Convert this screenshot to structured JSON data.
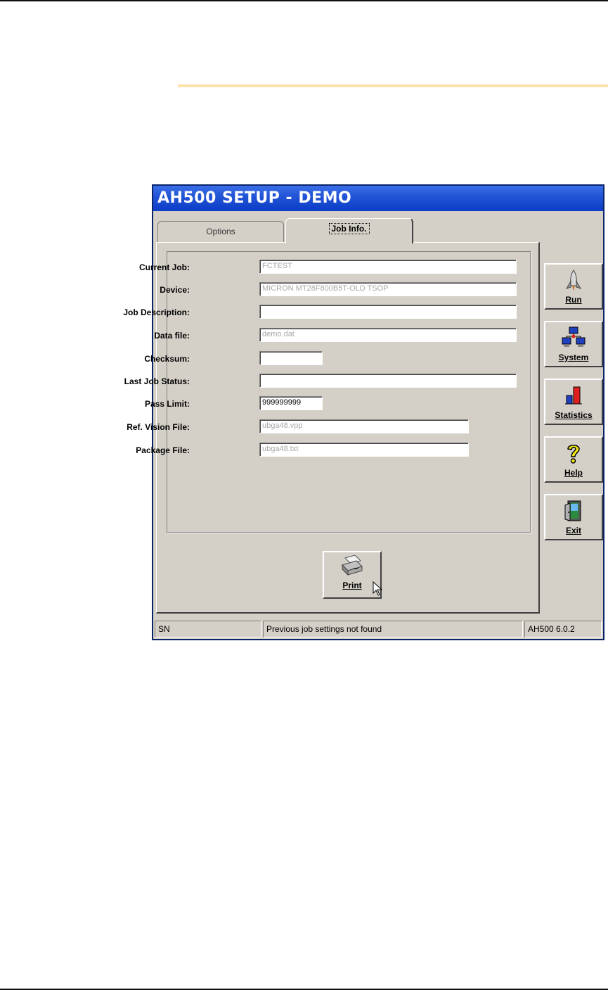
{
  "window": {
    "title": "AH500  SETUP  - DEMO"
  },
  "tabs": [
    {
      "label": "Options"
    },
    {
      "label": "Job Info."
    }
  ],
  "fields": {
    "current_job": {
      "label": "Current Job:",
      "value": "FCTEST"
    },
    "device": {
      "label": "Device:",
      "value": "MICRON MT28F800B5T-OLD TSOP"
    },
    "job_description": {
      "label": "Job Description:",
      "value": ""
    },
    "data_file": {
      "label": "Data file:",
      "value": "demo.dat"
    },
    "checksum": {
      "label": "Checksum:",
      "value": ""
    },
    "last_job_status": {
      "label": "Last Job Status:",
      "value": ""
    },
    "pass_limit": {
      "label": "Pass Limit:",
      "value": "999999999"
    },
    "ref_vision_file": {
      "label": "Ref. Vision File:",
      "value": "ubga48.vpp"
    },
    "package_file": {
      "label": "Package File:",
      "value": "ubga48.txt"
    }
  },
  "side_buttons": {
    "run": "Run",
    "system": "System",
    "statistics": "Statistics",
    "help": "Help",
    "exit": "Exit"
  },
  "print_button": "Print",
  "status": {
    "left": "SN",
    "message": "Previous job settings not found",
    "version": "AH500 6.0.2"
  },
  "icons": {
    "run": "rocket-icon",
    "system": "network-computers-icon",
    "statistics": "bar-chart-icon",
    "help": "question-mark-icon",
    "exit": "door-exit-icon",
    "print": "printer-icon"
  },
  "colors": {
    "titlebar": "#2356d6",
    "window_bg": "#d4d0c8",
    "accent_bar": "#fde3a7"
  }
}
